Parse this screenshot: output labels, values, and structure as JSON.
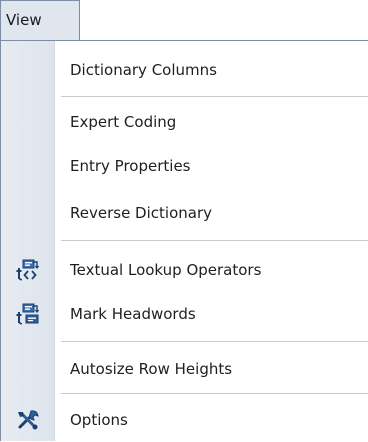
{
  "menu": {
    "title": "View",
    "items": [
      {
        "label": "Dictionary Columns",
        "icon": null
      },
      {
        "label": "Expert Coding",
        "icon": null
      },
      {
        "label": "Entry Properties",
        "icon": null
      },
      {
        "label": "Reverse Dictionary",
        "icon": null
      },
      {
        "label": "Textual Lookup Operators",
        "icon": "textual-lookup-operators-icon"
      },
      {
        "label": "Mark Headwords",
        "icon": "mark-headwords-icon"
      },
      {
        "label": "Autosize Row Heights",
        "icon": null
      },
      {
        "label": "Options",
        "icon": "tools-icon"
      }
    ]
  },
  "colors": {
    "menu_title_bg": "#dfe6ee",
    "border": "#7d8da6",
    "gutter": "#e3e9f0",
    "separator": "#c9c9c9",
    "icon_blue": "#2f5f9b",
    "icon_dark": "#1d3f70"
  }
}
